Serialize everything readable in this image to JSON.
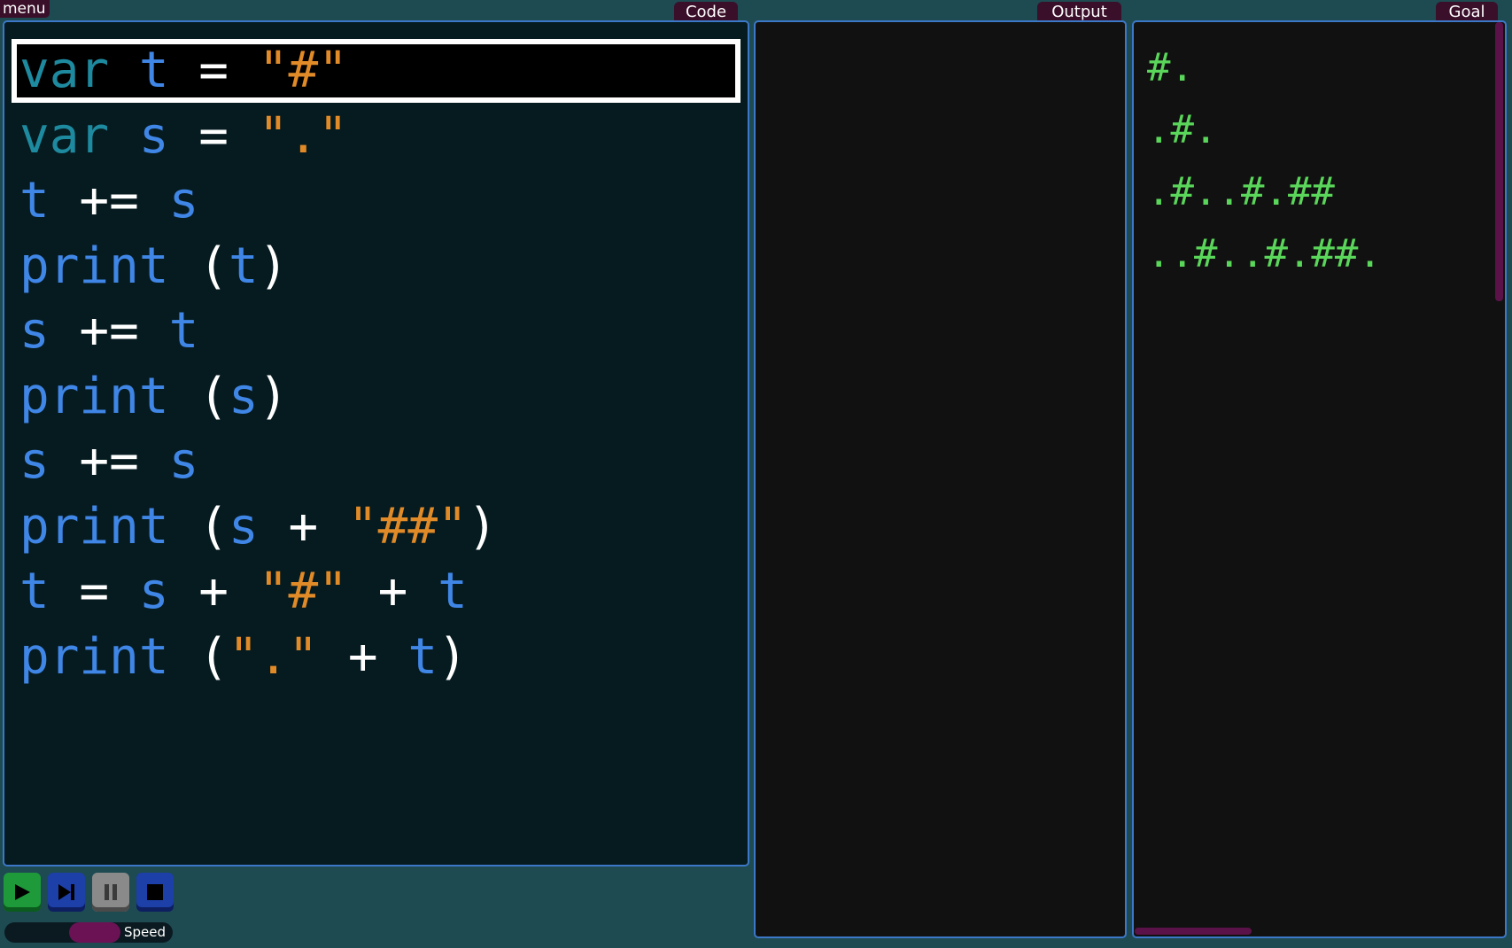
{
  "menu": {
    "label": "menu"
  },
  "panels": {
    "code": {
      "title": "Code"
    },
    "output": {
      "title": "Output",
      "lines": []
    },
    "goal": {
      "title": "Goal"
    }
  },
  "code_lines": [
    [
      [
        "kw",
        "var"
      ],
      [
        "op",
        " "
      ],
      [
        "id",
        "t"
      ],
      [
        "op",
        " = "
      ],
      [
        "str",
        "\"#\""
      ]
    ],
    [
      [
        "kw",
        "var"
      ],
      [
        "op",
        " "
      ],
      [
        "id",
        "s"
      ],
      [
        "op",
        " = "
      ],
      [
        "str",
        "\".\""
      ]
    ],
    [
      [
        "id",
        "t"
      ],
      [
        "op",
        " += "
      ],
      [
        "id",
        "s"
      ]
    ],
    [
      [
        "id",
        "print"
      ],
      [
        "op",
        " ("
      ],
      [
        "id",
        "t"
      ],
      [
        "op",
        ")"
      ]
    ],
    [
      [
        "id",
        "s"
      ],
      [
        "op",
        " += "
      ],
      [
        "id",
        "t"
      ]
    ],
    [
      [
        "id",
        "print"
      ],
      [
        "op",
        " ("
      ],
      [
        "id",
        "s"
      ],
      [
        "op",
        ")"
      ]
    ],
    [
      [
        "id",
        "s"
      ],
      [
        "op",
        " += "
      ],
      [
        "id",
        "s"
      ]
    ],
    [
      [
        "id",
        "print"
      ],
      [
        "op",
        " ("
      ],
      [
        "id",
        "s"
      ],
      [
        "op",
        " + "
      ],
      [
        "str",
        "\"##\""
      ],
      [
        "op",
        ")"
      ]
    ],
    [
      [
        "id",
        "t"
      ],
      [
        "op",
        " = "
      ],
      [
        "id",
        "s"
      ],
      [
        "op",
        " + "
      ],
      [
        "str",
        "\"#\""
      ],
      [
        "op",
        " + "
      ],
      [
        "id",
        "t"
      ]
    ],
    [
      [
        "id",
        "print"
      ],
      [
        "op",
        " ("
      ],
      [
        "str",
        "\".\""
      ],
      [
        "op",
        " + "
      ],
      [
        "id",
        "t"
      ],
      [
        "op",
        ")"
      ]
    ]
  ],
  "current_line_index": 0,
  "goal_lines": [
    "#.",
    ".#.",
    ".#..#.##",
    "..#..#.##."
  ],
  "controls": {
    "run_icon": "play-icon",
    "step_icon": "step-forward-icon",
    "pause_icon": "pause-icon",
    "stop_icon": "stop-icon"
  },
  "speed": {
    "label": "Speed",
    "level": 0.55
  },
  "colors": {
    "background": "#1e4a52",
    "keyword": "#1e8aa0",
    "identifier": "#3f86e6",
    "string": "#e08a28",
    "goal_text": "#5ad65a",
    "panel_border": "#3c78c8",
    "tab": "#3a0f2a"
  }
}
